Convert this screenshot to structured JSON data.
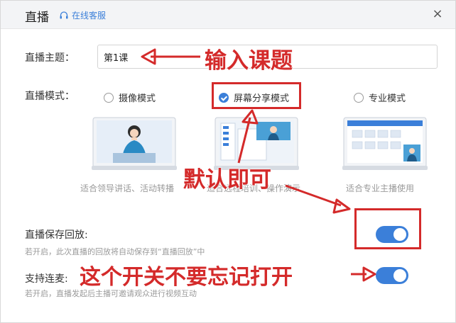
{
  "header": {
    "title": "直播",
    "service_label": "在线客服",
    "close_label": "×"
  },
  "topic": {
    "label": "直播主题：",
    "value": "第1课"
  },
  "mode": {
    "label": "直播模式：",
    "options": [
      {
        "label": "摄像模式",
        "selected": false,
        "desc": "适合领导讲话、活动转播"
      },
      {
        "label": "屏幕分享模式",
        "selected": true,
        "desc": "适合远程培训、操作演示"
      },
      {
        "label": "专业模式",
        "selected": false,
        "desc": "适合专业主播使用"
      }
    ]
  },
  "save_replay": {
    "label": "直播保存回放:",
    "desc": "若开启，此次直播的回放将自动保存到“直播回放”中",
    "enabled": true
  },
  "co_host": {
    "label": "支持连麦:",
    "desc": "若开启，直播发起后主播可邀请观众进行视频互动",
    "enabled": true
  },
  "annotations": {
    "input_topic": "输入课题",
    "default_ok": "默认即可",
    "switch_reminder": "这个开关不要忘记打开"
  },
  "colors": {
    "accent": "#3b7fd9",
    "annotation": "#d42a2a"
  }
}
